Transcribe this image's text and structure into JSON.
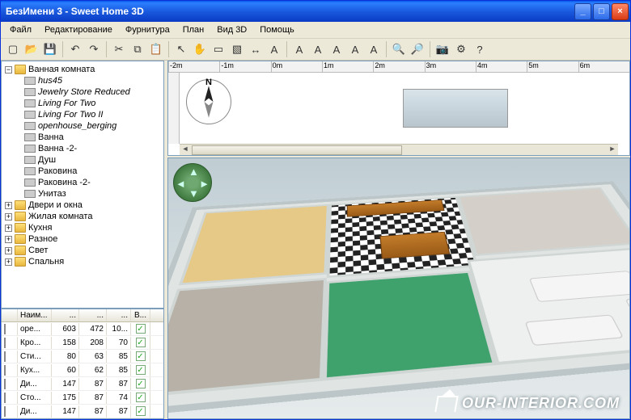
{
  "title": "БезИмени 3 - Sweet Home 3D",
  "menu": [
    "Файл",
    "Редактирование",
    "Фурнитура",
    "План",
    "Вид 3D",
    "Помощь"
  ],
  "toolbar_icons": [
    "new-file",
    "open-file",
    "save",
    "divider",
    "undo",
    "redo",
    "divider",
    "cut",
    "copy",
    "paste",
    "divider",
    "pointer",
    "pan",
    "wall",
    "room",
    "dimension",
    "text",
    "divider",
    "text-a1",
    "text-a2",
    "text-a3",
    "text-a4",
    "text-a5",
    "divider",
    "zoom-in",
    "zoom-out",
    "divider",
    "snapshot",
    "prefs",
    "help"
  ],
  "tree": {
    "root": "Ванная комната",
    "children": [
      "hus45",
      "Jewelry Store Reduced",
      "Living For Two",
      "Living For Two II",
      "openhouse_berging",
      "Ванна",
      "Ванна -2-",
      "Душ",
      "Раковина",
      "Раковина -2-",
      "Унитаз"
    ],
    "siblings": [
      "Двери и окна",
      "Жилая комната",
      "Кухня",
      "Разное",
      "Свет",
      "Спальня"
    ]
  },
  "table": {
    "headers": [
      "Наим...",
      "...",
      "...",
      "...",
      "В..."
    ],
    "rows": [
      {
        "name": "оре...",
        "a": 603,
        "b": 472,
        "c": "10..."
      },
      {
        "name": "Кро...",
        "a": 158,
        "b": 208,
        "c": 70
      },
      {
        "name": "Сти...",
        "a": 80,
        "b": 63,
        "c": 85
      },
      {
        "name": "Кух...",
        "a": 60,
        "b": 62,
        "c": 85
      },
      {
        "name": "Ди...",
        "a": 147,
        "b": 87,
        "c": 87
      },
      {
        "name": "Сто...",
        "a": 175,
        "b": 87,
        "c": 74
      },
      {
        "name": "Ди...",
        "a": 147,
        "b": 87,
        "c": 87
      }
    ]
  },
  "ruler": [
    "-2m",
    "-1m",
    "0m",
    "1m",
    "2m",
    "3m",
    "4m",
    "5m",
    "6m"
  ],
  "compass_label": "N",
  "watermark": "OUR-INTERIOR.COM"
}
